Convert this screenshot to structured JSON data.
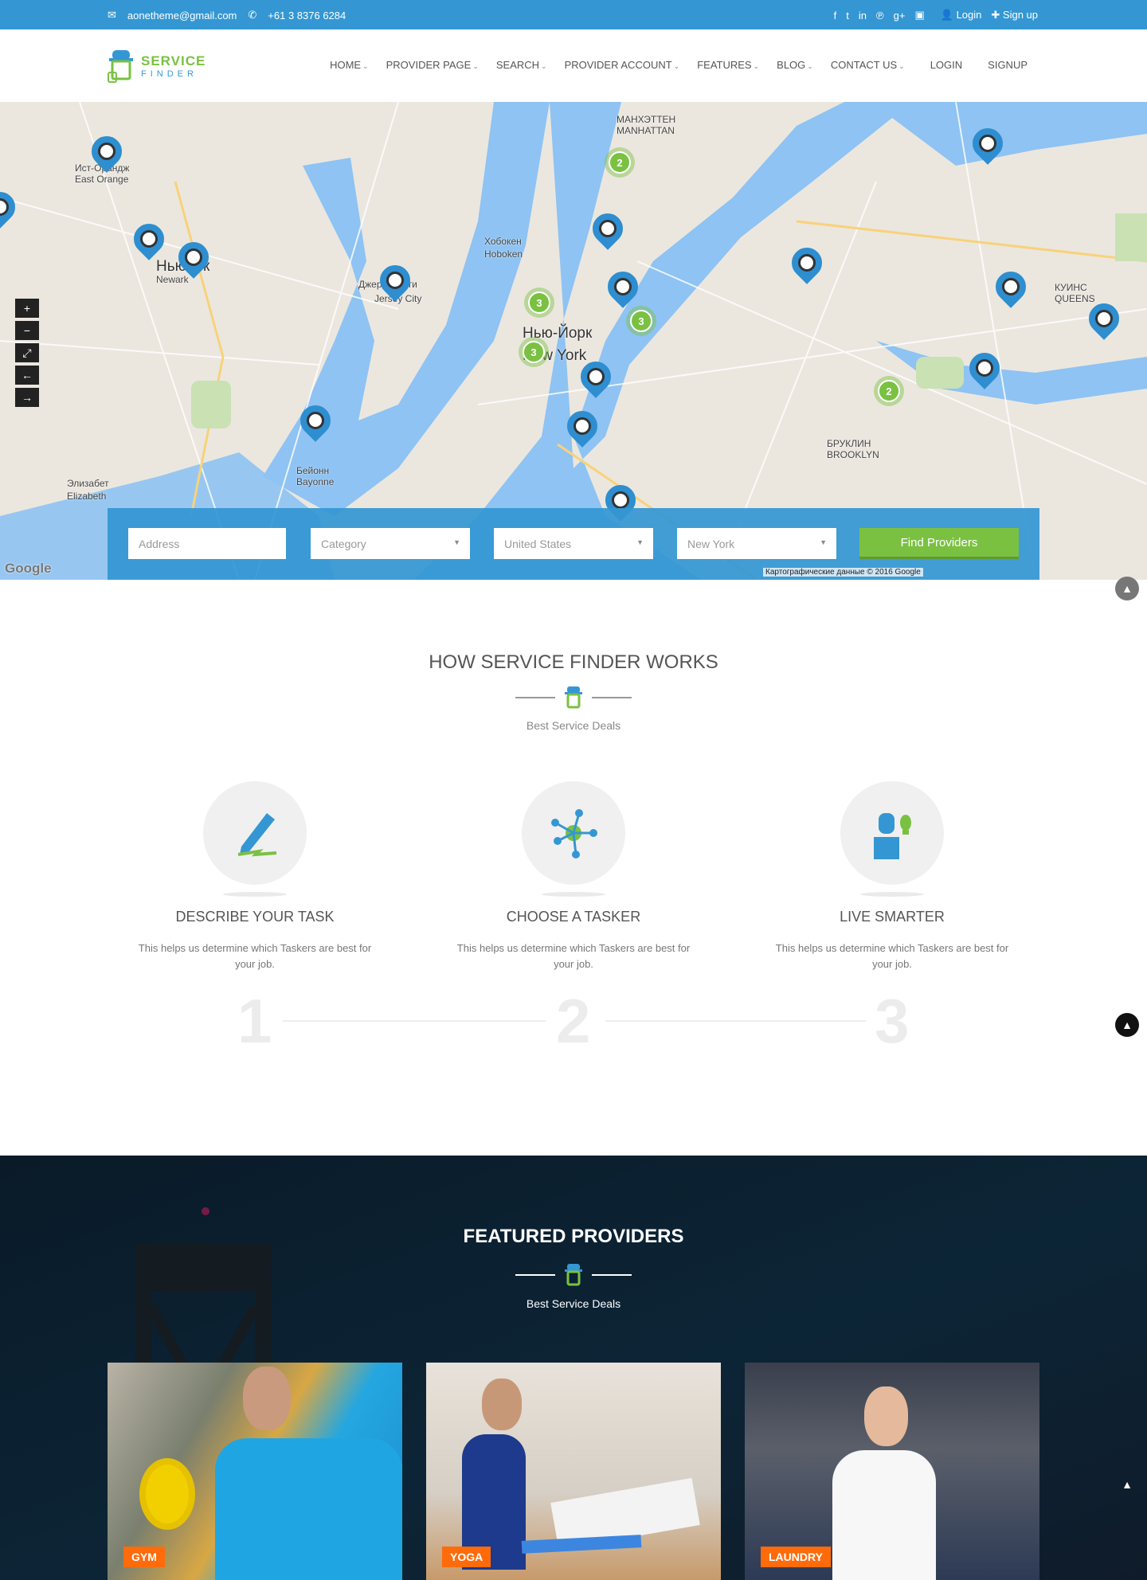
{
  "topbar": {
    "email": "aonetheme@gmail.com",
    "phone": "+61 3 8376 6284",
    "social": [
      "facebook-icon",
      "twitter-icon",
      "linkedin-icon",
      "pinterest-icon",
      "google-plus-icon",
      "instagram-icon"
    ],
    "login": "Login",
    "signup": "Sign up"
  },
  "logo": {
    "line1": "SERVICE",
    "line2": "FINDER"
  },
  "menu": [
    {
      "label": "HOME",
      "dropdown": true
    },
    {
      "label": "PROVIDER PAGE",
      "dropdown": true
    },
    {
      "label": "SEARCH",
      "dropdown": true
    },
    {
      "label": "PROVIDER ACCOUNT",
      "dropdown": true
    },
    {
      "label": "FEATURES",
      "dropdown": true
    },
    {
      "label": "BLOG",
      "dropdown": true
    },
    {
      "label": "CONTACT US",
      "dropdown": true
    },
    {
      "label": "LOGIN",
      "dropdown": false
    },
    {
      "label": "SIGNUP",
      "dropdown": false
    }
  ],
  "map": {
    "labels": [
      "Нью-Йорк",
      "New York",
      "Джерси-Сити",
      "Jersey City",
      "Хобокен",
      "Hoboken",
      "Ньюарк",
      "Newark",
      "БРУКЛИН",
      "BROOKLYN",
      "КУИНС",
      "QUEENS",
      "Элизабет",
      "Elizabeth",
      "Бейонн",
      "Bayonne",
      "Ист-Орандж",
      "East Orange",
      "МАНХЭТТЕН",
      "MANHATTAN"
    ],
    "clusters": [
      "2",
      "3",
      "3",
      "3",
      "2"
    ],
    "controls": [
      "+",
      "−",
      "⤢",
      "←",
      "→"
    ],
    "attribution": "Картографические данные © 2016 Google",
    "google": "Google"
  },
  "search": {
    "address_placeholder": "Address",
    "category": "Category",
    "country": "United States",
    "city": "New York",
    "button": "Find Providers"
  },
  "how": {
    "title": "HOW SERVICE FINDER WORKS",
    "subtitle": "Best Service Deals",
    "steps": [
      {
        "title": "DESCRIBE YOUR TASK",
        "desc": "This helps us determine which Taskers are best for your job.",
        "num": "1",
        "icon": "pen-icon"
      },
      {
        "title": "CHOOSE A TASKER",
        "desc": "This helps us determine which Taskers are best for your job.",
        "num": "2",
        "icon": "network-icon"
      },
      {
        "title": "LIVE SMARTER",
        "desc": "This helps us determine which Taskers are best for your job.",
        "num": "3",
        "icon": "person-idea-icon"
      }
    ]
  },
  "featured": {
    "title": "FEATURED PROVIDERS",
    "subtitle": "Best Service Deals",
    "cards": [
      {
        "badge": "GYM"
      },
      {
        "badge": "YOGA"
      },
      {
        "badge": "LAUNDRY"
      }
    ]
  },
  "colors": {
    "primary": "#3497d3",
    "accent": "#7ac142",
    "badge": "#ff6b0b"
  }
}
